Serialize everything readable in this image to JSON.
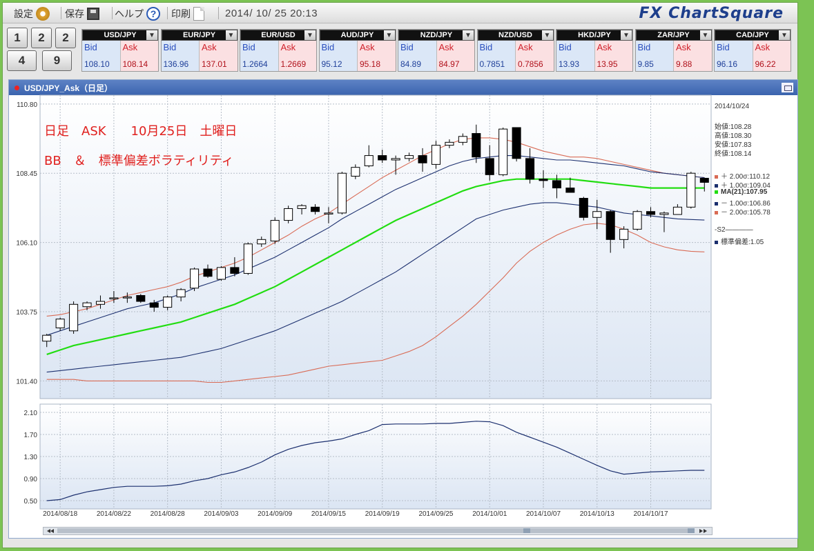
{
  "toolbar": {
    "settings_label": "設定",
    "save_label": "保存",
    "help_label": "ヘルプ",
    "print_label": "印刷",
    "datetime": "2014/ 10/ 25  20:13",
    "logo": "FX ChartSquare"
  },
  "layout_buttons": [
    "1",
    "2",
    "2",
    "4",
    "9"
  ],
  "quotes": [
    {
      "pair": "USD/JPY",
      "bid": "108.10",
      "ask": "108.14"
    },
    {
      "pair": "EUR/JPY",
      "bid": "136.96",
      "ask": "137.01"
    },
    {
      "pair": "EUR/USD",
      "bid": "1.2664",
      "ask": "1.2669"
    },
    {
      "pair": "AUD/JPY",
      "bid": "95.12",
      "ask": "95.18"
    },
    {
      "pair": "NZD/JPY",
      "bid": "84.89",
      "ask": "84.97"
    },
    {
      "pair": "NZD/USD",
      "bid": "0.7851",
      "ask": "0.7856"
    },
    {
      "pair": "HKD/JPY",
      "bid": "13.93",
      "ask": "13.95"
    },
    {
      "pair": "ZAR/JPY",
      "bid": "9.85",
      "ask": "9.88"
    },
    {
      "pair": "CAD/JPY",
      "bid": "96.16",
      "ask": "96.22"
    }
  ],
  "quote_labels": {
    "bid": "Bid",
    "ask": "Ask"
  },
  "chart_window": {
    "title": "USD/JPY_Ask（日足）"
  },
  "overlay_text": {
    "line1": "日足　ASK　　10月25日　土曜日",
    "line2": "BB　＆　標準偏差ボラティリティ"
  },
  "side_panel": {
    "date": "2014/10/24",
    "open": "始値:108.28",
    "high": "高値:108.30",
    "low": "安値:107.83",
    "close": "終値:108.14",
    "legend": [
      {
        "label": "＋ 2.00σ:110.12",
        "color": "#d96b55"
      },
      {
        "label": "＋ 1.00σ:109.04",
        "color": "#1b2f6e"
      },
      {
        "label": "MA(21):107.95",
        "color": "#22dd11"
      },
      {
        "label": "－ 1.00σ:106.86",
        "color": "#1b2f6e"
      },
      {
        "label": "－ 2.00σ:105.78",
        "color": "#d96b55"
      }
    ],
    "s2_label": "-S2",
    "s2_legend": {
      "label": "標準偏差:1.05",
      "color": "#1b2f6e"
    }
  },
  "chart_data": [
    {
      "type": "candlestick",
      "title": "USD/JPY_Ask（日足）",
      "ylim": [
        100.8,
        111.1
      ],
      "yticks": [
        101.4,
        103.75,
        106.1,
        108.45,
        110.8
      ],
      "ytick_labels": [
        "101.40",
        "103.75",
        "106.10",
        "108.45",
        "110.80"
      ],
      "xtick_labels": [
        "2014/08/18",
        "2014/08/22",
        "2014/08/28",
        "2014/09/03",
        "2014/09/09",
        "2014/09/15",
        "2014/09/19",
        "2014/09/25",
        "2014/10/01",
        "2014/10/07",
        "2014/10/13",
        "2014/10/17"
      ],
      "xtick_index": [
        1,
        5,
        9,
        13,
        17,
        21,
        25,
        29,
        33,
        37,
        41,
        45
      ],
      "candles": [
        [
          102.75,
          103.0,
          102.55,
          102.95
        ],
        [
          103.2,
          103.55,
          103.1,
          103.5
        ],
        [
          103.1,
          104.1,
          103.0,
          104.0
        ],
        [
          103.92,
          104.1,
          103.8,
          104.05
        ],
        [
          104.0,
          104.3,
          103.85,
          104.1
        ],
        [
          104.2,
          104.45,
          104.05,
          104.22
        ],
        [
          104.25,
          104.4,
          104.05,
          104.25
        ],
        [
          104.3,
          104.35,
          104.05,
          104.1
        ],
        [
          104.05,
          104.15,
          103.75,
          103.9
        ],
        [
          103.9,
          104.3,
          103.8,
          104.25
        ],
        [
          104.25,
          104.55,
          104.1,
          104.5
        ],
        [
          104.55,
          105.25,
          104.45,
          105.2
        ],
        [
          105.2,
          105.35,
          104.9,
          104.95
        ],
        [
          104.85,
          105.3,
          104.8,
          105.25
        ],
        [
          105.25,
          105.6,
          104.95,
          105.05
        ],
        [
          105.05,
          106.1,
          105.0,
          106.05
        ],
        [
          106.05,
          106.3,
          105.95,
          106.2
        ],
        [
          106.15,
          106.95,
          106.05,
          106.85
        ],
        [
          106.85,
          107.35,
          106.75,
          107.25
        ],
        [
          107.25,
          107.4,
          107.05,
          107.35
        ],
        [
          107.3,
          107.4,
          107.05,
          107.15
        ],
        [
          107.1,
          107.3,
          106.75,
          107.1
        ],
        [
          107.1,
          108.5,
          107.05,
          108.45
        ],
        [
          108.35,
          108.75,
          108.25,
          108.65
        ],
        [
          108.7,
          109.4,
          108.65,
          109.05
        ],
        [
          109.05,
          109.25,
          108.8,
          108.9
        ],
        [
          108.9,
          109.05,
          108.4,
          108.95
        ],
        [
          108.95,
          109.15,
          108.85,
          109.05
        ],
        [
          109.05,
          109.3,
          108.5,
          108.8
        ],
        [
          108.75,
          109.55,
          108.6,
          109.4
        ],
        [
          109.4,
          109.6,
          109.3,
          109.5
        ],
        [
          109.5,
          109.8,
          109.4,
          109.7
        ],
        [
          109.8,
          110.1,
          108.8,
          109.0
        ],
        [
          108.95,
          109.4,
          108.2,
          108.4
        ],
        [
          108.4,
          110.0,
          108.35,
          109.95
        ],
        [
          110.0,
          110.0,
          108.85,
          108.95
        ],
        [
          108.95,
          109.3,
          108.1,
          108.25
        ],
        [
          108.25,
          108.55,
          107.95,
          108.2
        ],
        [
          108.2,
          108.4,
          107.6,
          107.95
        ],
        [
          107.95,
          108.3,
          107.85,
          107.8
        ],
        [
          107.6,
          107.65,
          106.85,
          106.95
        ],
        [
          106.95,
          107.55,
          106.55,
          107.15
        ],
        [
          107.15,
          107.2,
          105.75,
          106.2
        ],
        [
          106.2,
          106.65,
          105.9,
          106.55
        ],
        [
          106.55,
          107.2,
          106.5,
          107.15
        ],
        [
          107.15,
          107.3,
          106.95,
          107.05
        ],
        [
          107.05,
          107.15,
          106.45,
          107.1
        ],
        [
          107.05,
          107.4,
          107.05,
          107.3
        ],
        [
          107.3,
          108.5,
          107.25,
          108.45
        ],
        [
          108.28,
          108.3,
          107.83,
          108.14
        ]
      ],
      "series": [
        {
          "name": "+ 2.00σ",
          "color": "#d96b55",
          "values": [
            103.6,
            103.65,
            103.75,
            103.85,
            104.0,
            104.15,
            104.3,
            104.4,
            104.5,
            104.6,
            104.75,
            104.95,
            105.1,
            105.25,
            105.4,
            105.6,
            105.85,
            106.1,
            106.35,
            106.65,
            106.9,
            107.1,
            107.4,
            107.7,
            108.0,
            108.3,
            108.55,
            108.8,
            109.05,
            109.25,
            109.45,
            109.6,
            109.65,
            109.65,
            109.6,
            109.5,
            109.35,
            109.2,
            109.1,
            109.0,
            109.0,
            108.95,
            108.85,
            108.75,
            108.65,
            108.55,
            108.45,
            108.4,
            108.35,
            108.3
          ]
        },
        {
          "name": "+ 1.00σ",
          "color": "#1b2f6e",
          "values": [
            102.95,
            103.1,
            103.25,
            103.4,
            103.55,
            103.7,
            103.85,
            103.95,
            104.05,
            104.2,
            104.35,
            104.55,
            104.7,
            104.85,
            105.0,
            105.2,
            105.4,
            105.6,
            105.85,
            106.1,
            106.35,
            106.6,
            106.9,
            107.15,
            107.4,
            107.65,
            107.9,
            108.1,
            108.3,
            108.5,
            108.7,
            108.85,
            108.95,
            109.0,
            109.05,
            109.05,
            109.0,
            108.95,
            108.9,
            108.9,
            108.85,
            108.8,
            108.75,
            108.7,
            108.6,
            108.5,
            108.45,
            108.4,
            108.35,
            108.3
          ]
        },
        {
          "name": "MA(21)",
          "color": "#22dd11",
          "values": [
            102.3,
            102.45,
            102.6,
            102.7,
            102.8,
            102.9,
            103.0,
            103.1,
            103.2,
            103.3,
            103.4,
            103.55,
            103.7,
            103.85,
            104.0,
            104.2,
            104.4,
            104.6,
            104.85,
            105.1,
            105.35,
            105.6,
            105.85,
            106.1,
            106.35,
            106.6,
            106.85,
            107.05,
            107.25,
            107.45,
            107.65,
            107.85,
            108.0,
            108.1,
            108.2,
            108.25,
            108.25,
            108.25,
            108.25,
            108.25,
            108.2,
            108.15,
            108.1,
            108.05,
            108.0,
            107.95,
            107.95,
            107.95,
            107.95,
            107.95
          ]
        },
        {
          "name": "− 1.00σ",
          "color": "#1b2f6e",
          "values": [
            101.7,
            101.75,
            101.8,
            101.85,
            101.9,
            101.95,
            102.0,
            102.05,
            102.1,
            102.15,
            102.2,
            102.3,
            102.4,
            102.5,
            102.65,
            102.8,
            102.95,
            103.1,
            103.3,
            103.5,
            103.7,
            103.9,
            104.1,
            104.35,
            104.6,
            104.85,
            105.1,
            105.4,
            105.7,
            106.0,
            106.3,
            106.6,
            106.9,
            107.05,
            107.2,
            107.3,
            107.4,
            107.45,
            107.45,
            107.4,
            107.35,
            107.3,
            107.2,
            107.1,
            107.05,
            107.0,
            106.95,
            106.9,
            106.88,
            106.86
          ]
        },
        {
          "name": "− 2.00σ",
          "color": "#d96b55",
          "values": [
            101.45,
            101.45,
            101.45,
            101.4,
            101.4,
            101.4,
            101.4,
            101.4,
            101.4,
            101.4,
            101.4,
            101.4,
            101.35,
            101.35,
            101.4,
            101.45,
            101.5,
            101.55,
            101.6,
            101.7,
            101.8,
            101.9,
            101.95,
            102.0,
            102.05,
            102.1,
            102.25,
            102.4,
            102.6,
            102.9,
            103.25,
            103.6,
            104.0,
            104.45,
            104.9,
            105.4,
            105.8,
            106.1,
            106.35,
            106.55,
            106.7,
            106.75,
            106.7,
            106.55,
            106.35,
            106.1,
            105.95,
            105.85,
            105.8,
            105.78
          ]
        }
      ]
    },
    {
      "type": "line",
      "title": "",
      "ylim": [
        0.35,
        2.25
      ],
      "yticks": [
        0.5,
        0.9,
        1.3,
        1.7,
        2.1
      ],
      "ytick_labels": [
        "0.50",
        "0.90",
        "1.30",
        "1.70",
        "2.10"
      ],
      "series": [
        {
          "name": "標準偏差",
          "color": "#1b2f6e",
          "values": [
            0.5,
            0.52,
            0.6,
            0.66,
            0.7,
            0.74,
            0.76,
            0.76,
            0.76,
            0.77,
            0.8,
            0.86,
            0.9,
            0.97,
            1.02,
            1.1,
            1.2,
            1.33,
            1.43,
            1.5,
            1.55,
            1.58,
            1.62,
            1.7,
            1.77,
            1.88,
            1.89,
            1.89,
            1.89,
            1.9,
            1.9,
            1.92,
            1.94,
            1.93,
            1.86,
            1.74,
            1.65,
            1.56,
            1.47,
            1.36,
            1.25,
            1.14,
            1.04,
            0.98,
            1.0,
            1.02,
            1.03,
            1.04,
            1.05,
            1.05
          ]
        }
      ]
    }
  ]
}
